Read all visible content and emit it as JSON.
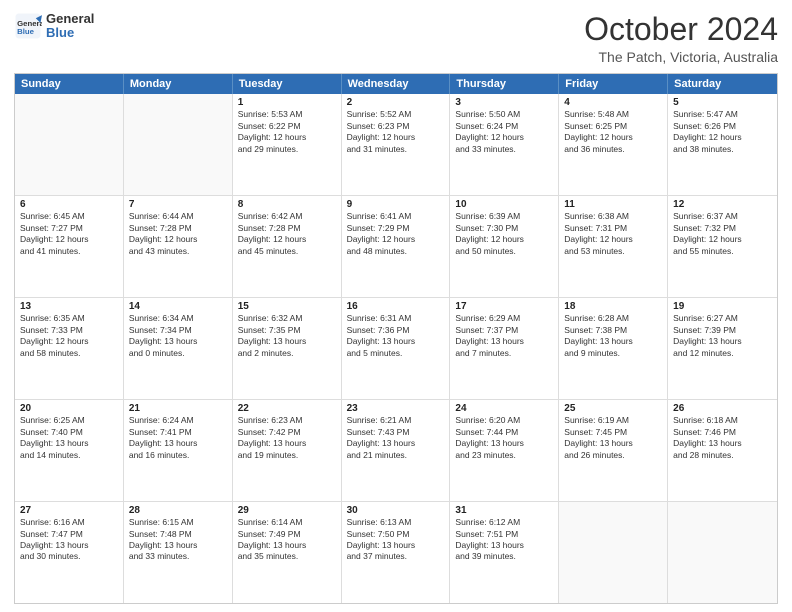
{
  "header": {
    "logo_line1": "General",
    "logo_line2": "Blue",
    "title": "October 2024",
    "subtitle": "The Patch, Victoria, Australia"
  },
  "calendar": {
    "days": [
      "Sunday",
      "Monday",
      "Tuesday",
      "Wednesday",
      "Thursday",
      "Friday",
      "Saturday"
    ],
    "weeks": [
      [
        {
          "num": "",
          "lines": []
        },
        {
          "num": "",
          "lines": []
        },
        {
          "num": "1",
          "lines": [
            "Sunrise: 5:53 AM",
            "Sunset: 6:22 PM",
            "Daylight: 12 hours",
            "and 29 minutes."
          ]
        },
        {
          "num": "2",
          "lines": [
            "Sunrise: 5:52 AM",
            "Sunset: 6:23 PM",
            "Daylight: 12 hours",
            "and 31 minutes."
          ]
        },
        {
          "num": "3",
          "lines": [
            "Sunrise: 5:50 AM",
            "Sunset: 6:24 PM",
            "Daylight: 12 hours",
            "and 33 minutes."
          ]
        },
        {
          "num": "4",
          "lines": [
            "Sunrise: 5:48 AM",
            "Sunset: 6:25 PM",
            "Daylight: 12 hours",
            "and 36 minutes."
          ]
        },
        {
          "num": "5",
          "lines": [
            "Sunrise: 5:47 AM",
            "Sunset: 6:26 PM",
            "Daylight: 12 hours",
            "and 38 minutes."
          ]
        }
      ],
      [
        {
          "num": "6",
          "lines": [
            "Sunrise: 6:45 AM",
            "Sunset: 7:27 PM",
            "Daylight: 12 hours",
            "and 41 minutes."
          ]
        },
        {
          "num": "7",
          "lines": [
            "Sunrise: 6:44 AM",
            "Sunset: 7:28 PM",
            "Daylight: 12 hours",
            "and 43 minutes."
          ]
        },
        {
          "num": "8",
          "lines": [
            "Sunrise: 6:42 AM",
            "Sunset: 7:28 PM",
            "Daylight: 12 hours",
            "and 45 minutes."
          ]
        },
        {
          "num": "9",
          "lines": [
            "Sunrise: 6:41 AM",
            "Sunset: 7:29 PM",
            "Daylight: 12 hours",
            "and 48 minutes."
          ]
        },
        {
          "num": "10",
          "lines": [
            "Sunrise: 6:39 AM",
            "Sunset: 7:30 PM",
            "Daylight: 12 hours",
            "and 50 minutes."
          ]
        },
        {
          "num": "11",
          "lines": [
            "Sunrise: 6:38 AM",
            "Sunset: 7:31 PM",
            "Daylight: 12 hours",
            "and 53 minutes."
          ]
        },
        {
          "num": "12",
          "lines": [
            "Sunrise: 6:37 AM",
            "Sunset: 7:32 PM",
            "Daylight: 12 hours",
            "and 55 minutes."
          ]
        }
      ],
      [
        {
          "num": "13",
          "lines": [
            "Sunrise: 6:35 AM",
            "Sunset: 7:33 PM",
            "Daylight: 12 hours",
            "and 58 minutes."
          ]
        },
        {
          "num": "14",
          "lines": [
            "Sunrise: 6:34 AM",
            "Sunset: 7:34 PM",
            "Daylight: 13 hours",
            "and 0 minutes."
          ]
        },
        {
          "num": "15",
          "lines": [
            "Sunrise: 6:32 AM",
            "Sunset: 7:35 PM",
            "Daylight: 13 hours",
            "and 2 minutes."
          ]
        },
        {
          "num": "16",
          "lines": [
            "Sunrise: 6:31 AM",
            "Sunset: 7:36 PM",
            "Daylight: 13 hours",
            "and 5 minutes."
          ]
        },
        {
          "num": "17",
          "lines": [
            "Sunrise: 6:29 AM",
            "Sunset: 7:37 PM",
            "Daylight: 13 hours",
            "and 7 minutes."
          ]
        },
        {
          "num": "18",
          "lines": [
            "Sunrise: 6:28 AM",
            "Sunset: 7:38 PM",
            "Daylight: 13 hours",
            "and 9 minutes."
          ]
        },
        {
          "num": "19",
          "lines": [
            "Sunrise: 6:27 AM",
            "Sunset: 7:39 PM",
            "Daylight: 13 hours",
            "and 12 minutes."
          ]
        }
      ],
      [
        {
          "num": "20",
          "lines": [
            "Sunrise: 6:25 AM",
            "Sunset: 7:40 PM",
            "Daylight: 13 hours",
            "and 14 minutes."
          ]
        },
        {
          "num": "21",
          "lines": [
            "Sunrise: 6:24 AM",
            "Sunset: 7:41 PM",
            "Daylight: 13 hours",
            "and 16 minutes."
          ]
        },
        {
          "num": "22",
          "lines": [
            "Sunrise: 6:23 AM",
            "Sunset: 7:42 PM",
            "Daylight: 13 hours",
            "and 19 minutes."
          ]
        },
        {
          "num": "23",
          "lines": [
            "Sunrise: 6:21 AM",
            "Sunset: 7:43 PM",
            "Daylight: 13 hours",
            "and 21 minutes."
          ]
        },
        {
          "num": "24",
          "lines": [
            "Sunrise: 6:20 AM",
            "Sunset: 7:44 PM",
            "Daylight: 13 hours",
            "and 23 minutes."
          ]
        },
        {
          "num": "25",
          "lines": [
            "Sunrise: 6:19 AM",
            "Sunset: 7:45 PM",
            "Daylight: 13 hours",
            "and 26 minutes."
          ]
        },
        {
          "num": "26",
          "lines": [
            "Sunrise: 6:18 AM",
            "Sunset: 7:46 PM",
            "Daylight: 13 hours",
            "and 28 minutes."
          ]
        }
      ],
      [
        {
          "num": "27",
          "lines": [
            "Sunrise: 6:16 AM",
            "Sunset: 7:47 PM",
            "Daylight: 13 hours",
            "and 30 minutes."
          ]
        },
        {
          "num": "28",
          "lines": [
            "Sunrise: 6:15 AM",
            "Sunset: 7:48 PM",
            "Daylight: 13 hours",
            "and 33 minutes."
          ]
        },
        {
          "num": "29",
          "lines": [
            "Sunrise: 6:14 AM",
            "Sunset: 7:49 PM",
            "Daylight: 13 hours",
            "and 35 minutes."
          ]
        },
        {
          "num": "30",
          "lines": [
            "Sunrise: 6:13 AM",
            "Sunset: 7:50 PM",
            "Daylight: 13 hours",
            "and 37 minutes."
          ]
        },
        {
          "num": "31",
          "lines": [
            "Sunrise: 6:12 AM",
            "Sunset: 7:51 PM",
            "Daylight: 13 hours",
            "and 39 minutes."
          ]
        },
        {
          "num": "",
          "lines": []
        },
        {
          "num": "",
          "lines": []
        }
      ]
    ]
  }
}
